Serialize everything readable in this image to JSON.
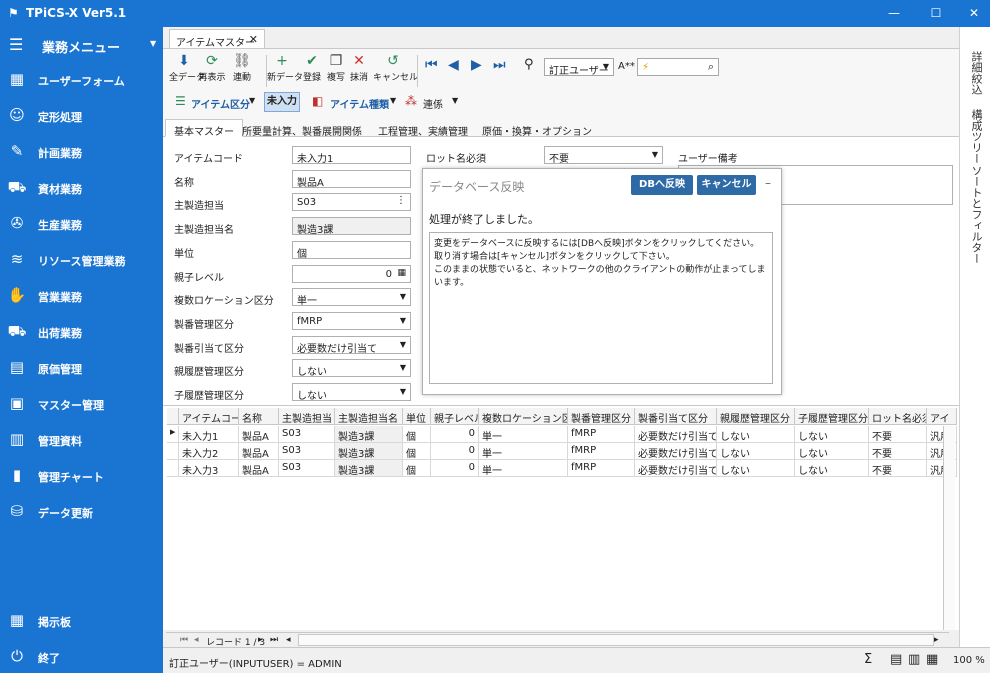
{
  "window": {
    "title": "TPiCS-X Ver5.1"
  },
  "sidebar": {
    "menu_label": "業務メニュー",
    "items": [
      {
        "label": "ユーザーフォーム",
        "icon": "user-form-icon",
        "glyph": "▦"
      },
      {
        "label": "定形処理",
        "icon": "robot-icon",
        "glyph": "☺"
      },
      {
        "label": "計画業務",
        "icon": "planning-icon",
        "glyph": "✎"
      },
      {
        "label": "資材業務",
        "icon": "forklift-icon",
        "glyph": "⛟"
      },
      {
        "label": "生産業務",
        "icon": "wrench-icon",
        "glyph": "✇"
      },
      {
        "label": "リソース管理業務",
        "icon": "resource-icon",
        "glyph": "≋"
      },
      {
        "label": "営業業務",
        "icon": "handshake-icon",
        "glyph": "✋"
      },
      {
        "label": "出荷業務",
        "icon": "truck-icon",
        "glyph": "⛟"
      },
      {
        "label": "原価管理",
        "icon": "cost-icon",
        "glyph": "▤"
      },
      {
        "label": "マスター管理",
        "icon": "master-icon",
        "glyph": "▣"
      },
      {
        "label": "管理資料",
        "icon": "document-icon",
        "glyph": "▥"
      },
      {
        "label": "管理チャート",
        "icon": "chart-icon",
        "glyph": "▮"
      },
      {
        "label": "データ更新",
        "icon": "database-icon",
        "glyph": "⛁"
      }
    ],
    "bottom_items": [
      {
        "label": "掲示板",
        "icon": "bulletin-icon",
        "glyph": "▦"
      },
      {
        "label": "終了",
        "icon": "power-icon",
        "glyph": "⏻"
      }
    ]
  },
  "right_panel": {
    "tabs": [
      "詳細絞込",
      "構成ツリー",
      "ソートとフィルター"
    ]
  },
  "document_tab": {
    "label": "アイテムマスター"
  },
  "toolbar": {
    "buttons": [
      {
        "label": "全データ",
        "icon": "download-icon",
        "glyph": "⬇",
        "color": "#1f5fa8"
      },
      {
        "label": "再表示",
        "icon": "refresh-icon",
        "glyph": "⟳",
        "color": "#2e8b57"
      },
      {
        "label": "連動",
        "icon": "link-icon",
        "glyph": "⛓",
        "color": "#555555"
      },
      {
        "label": "新データ",
        "icon": "add-icon",
        "glyph": "+",
        "color": "#2e8b57"
      },
      {
        "label": "登録",
        "icon": "check-icon",
        "glyph": "✔",
        "color": "#2e8b57"
      },
      {
        "label": "複写",
        "icon": "copy-icon",
        "glyph": "❐",
        "color": "#444444"
      },
      {
        "label": "抹消",
        "icon": "delete-icon",
        "glyph": "✕",
        "color": "#d03030"
      },
      {
        "label": "キャンセル",
        "icon": "undo-icon",
        "glyph": "↺",
        "color": "#2e8b57"
      }
    ],
    "nav_icons": [
      "first-record-icon",
      "prev-record-icon",
      "next-record-icon",
      "last-record-icon"
    ],
    "user_combo": "訂正ユーザー",
    "font_label": "A**",
    "search_placeholder": "",
    "item_category": "アイテム区分",
    "status_chip": "未入力",
    "item_type": "アイテム種類",
    "link_label": "連係"
  },
  "inner_tabs": [
    "基本マスター",
    "所要量計算、製番展開関係",
    "工程管理、実績管理",
    "原価・換算・オプション"
  ],
  "form": {
    "fields": [
      {
        "label": "アイテムコード",
        "value": "未入力1",
        "kind": "text"
      },
      {
        "label": "名称",
        "value": "製品A",
        "kind": "text"
      },
      {
        "label": "主製造担当",
        "value": "S03",
        "kind": "text"
      },
      {
        "label": "主製造担当名",
        "value": "製造3課",
        "kind": "readonly"
      },
      {
        "label": "単位",
        "value": "個",
        "kind": "text"
      },
      {
        "label": "親子レベル",
        "value": "0",
        "kind": "number"
      },
      {
        "label": "複数ロケーション区分",
        "value": "単一",
        "kind": "combo"
      },
      {
        "label": "製番管理区分",
        "value": "fMRP",
        "kind": "combo"
      },
      {
        "label": "製番引当て区分",
        "value": "必要数だけ引当て",
        "kind": "combo"
      },
      {
        "label": "親履歴管理区分",
        "value": "しない",
        "kind": "combo"
      },
      {
        "label": "子履歴管理区分",
        "value": "しない",
        "kind": "combo"
      }
    ],
    "lot_label": "ロット名必須",
    "lot_value": "不要",
    "user_note_label": "ユーザー備考"
  },
  "dialog": {
    "title": "データベース反映",
    "apply_button": "DBへ反映",
    "cancel_button": "キャンセル",
    "heading": "処理が終了しました。",
    "lines": [
      "変更をデータベースに反映するには[DBへ反映]ボタンをクリックしてください。",
      "取り消す場合は[キャンセル]ボタンをクリックして下さい。",
      "このままの状態でいると、ネットワークの他のクライアントの動作が止まってしまいます。"
    ]
  },
  "grid": {
    "columns": [
      "アイテムコード",
      "名称",
      "主製造担当",
      "主製造担当名",
      "単位",
      "親子レベル",
      "複数ロケーション区分",
      "製番管理区分",
      "製番引当て区分",
      "親履歴管理区分",
      "子履歴管理区分",
      "ロット名必須",
      "アイ"
    ],
    "rows": [
      [
        "未入力1",
        "製品A",
        "S03",
        "製造3課",
        "個",
        "0",
        "単一",
        "fMRP",
        "必要数だけ引当て",
        "しない",
        "しない",
        "不要",
        "汎用"
      ],
      [
        "未入力2",
        "製品A",
        "S03",
        "製造3課",
        "個",
        "0",
        "単一",
        "fMRP",
        "必要数だけ引当て",
        "しない",
        "しない",
        "不要",
        "汎用"
      ],
      [
        "未入力3",
        "製品A",
        "S03",
        "製造3課",
        "個",
        "0",
        "単一",
        "fMRP",
        "必要数だけ引当て",
        "しない",
        "しない",
        "不要",
        "汎用"
      ]
    ],
    "pager_label": "レコード 1 / 3"
  },
  "status": {
    "text": "訂正ユーザー(INPUTUSER) = ADMIN",
    "zoom": "100 %",
    "sum_icon": "sum-icon"
  }
}
